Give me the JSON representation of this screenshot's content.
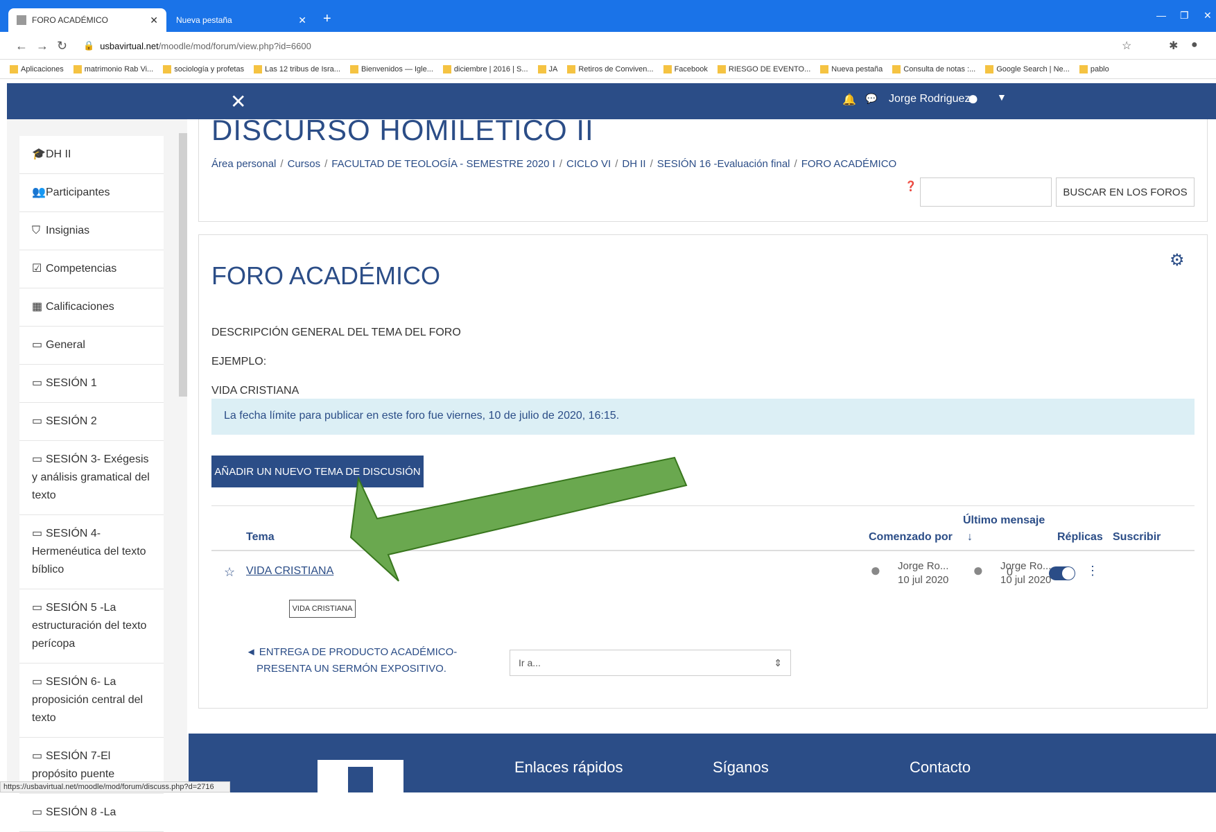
{
  "browser": {
    "tab_active": "FORO ACADÉMICO",
    "tab_second": "Nueva pestaña",
    "url_host": "usbavirtual.net",
    "url_path": "/moodle/mod/forum/view.php?id=6600",
    "bookmarks": [
      "Aplicaciones",
      "matrimonio Rab Vi...",
      "sociología y profetas",
      "Las 12 tribus de Isra...",
      "Bienvenidos — Igle...",
      "diciembre | 2016 | S...",
      "JA",
      "Retiros de Conviven...",
      "Facebook",
      "RIESGO DE EVENTO...",
      "Nueva pestaña",
      "Consulta de notas :...",
      "Google Search | Ne...",
      "pablo"
    ]
  },
  "topbar": {
    "user_name": "Jorge Rodriguez"
  },
  "sidebar": {
    "items": [
      {
        "icon": "🎓",
        "label": "DH II"
      },
      {
        "icon": "👥",
        "label": "Participantes"
      },
      {
        "icon": "⛉",
        "label": "Insignias"
      },
      {
        "icon": "☑",
        "label": "Competencias"
      },
      {
        "icon": "▦",
        "label": "Calificaciones"
      },
      {
        "icon": "▭",
        "label": "General"
      },
      {
        "icon": "▭",
        "label": "SESIÓN 1"
      },
      {
        "icon": "▭",
        "label": "SESIÓN 2"
      },
      {
        "icon": "▭",
        "label": "SESIÓN 3- Exégesis y análisis gramatical del texto"
      },
      {
        "icon": "▭",
        "label": "SESIÓN 4- Hermenéutica del texto bíblico"
      },
      {
        "icon": "▭",
        "label": "SESIÓN 5 -La estructuración del texto perícopa"
      },
      {
        "icon": "▭",
        "label": "SESIÓN 6- La proposición central del texto"
      },
      {
        "icon": "▭",
        "label": "SESIÓN 7-El propósito puente"
      },
      {
        "icon": "▭",
        "label": "SESIÓN 8 -La"
      }
    ]
  },
  "course": {
    "title": "DISCURSO HOMILÉTICO II",
    "breadcrumb": [
      "Área personal",
      "Cursos",
      "FACULTAD DE TEOLOGÍA - SEMESTRE 2020 I",
      "CICLO VI",
      "DH II",
      "SESIÓN 16 -Evaluación final",
      "FORO ACADÉMICO"
    ],
    "search_button": "BUSCAR EN LOS FOROS"
  },
  "forum": {
    "title": "FORO ACADÉMICO",
    "desc1": "DESCRIPCIÓN GENERAL DEL TEMA DEL FORO",
    "desc2": "EJEMPLO:",
    "desc3": "VIDA CRISTIANA",
    "alert": "La fecha límite para publicar en este foro fue viernes, 10 de julio de 2020, 16:15.",
    "add_button": "AÑADIR UN NUEVO TEMA DE DISCUSIÓN",
    "headers": {
      "topic": "Tema",
      "started": "Comenzado por",
      "last": "Último mensaje",
      "last_arrow": "↓",
      "replies": "Réplicas",
      "subscribe": "Suscribir"
    },
    "row": {
      "topic": "VIDA CRISTIANA",
      "started_name": "Jorge Ro...",
      "started_date": "10 jul 2020",
      "last_name": "Jorge Ro...",
      "last_date": "10 jul 2020",
      "replies": "0"
    },
    "tooltip": "VIDA CRISTIANA",
    "prev_link": "◄ ENTREGA DE PRODUCTO ACADÉMICO-PRESENTA UN SERMÓN EXPOSITIVO.",
    "jump_select": "Ir a..."
  },
  "footer": {
    "col1": "Enlaces rápidos",
    "col2": "Síganos",
    "col3": "Contacto"
  },
  "status_url": "https://usbavirtual.net/moodle/mod/forum/discuss.php?d=2716",
  "colors": {
    "brand": "#2b4d87",
    "arrow": "#6aa84f"
  }
}
